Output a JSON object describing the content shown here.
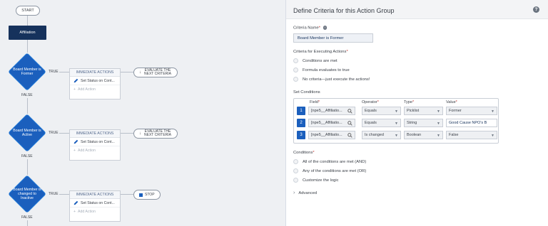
{
  "canvas": {
    "start_label": "START",
    "object_label": "Affiliation",
    "true_label": "TRUE",
    "false_label": "FALSE",
    "criteria": [
      {
        "label": "Board Member is Former",
        "action_header": "IMMEDIATE ACTIONS",
        "action": "Set Status on Cont...",
        "add_action": "Add Action",
        "outcome": "EVALUATE THE NEXT CRITERIA"
      },
      {
        "label": "Board Member is Active",
        "action_header": "IMMEDIATE ACTIONS",
        "action": "Set Status on Cont...",
        "add_action": "Add Action",
        "outcome": "EVALUATE THE NEXT CRITERIA"
      },
      {
        "label": "Board Member is changed to Inactive",
        "action_header": "IMMEDIATE ACTIONS",
        "action": "Set Status on Cont...",
        "add_action": "Add Action",
        "outcome": "STOP"
      }
    ]
  },
  "panel": {
    "title": "Define Criteria for this Action Group",
    "criteria_name_label": "Criteria Name",
    "criteria_name_value": "Board Member is Former",
    "executing_label": "Criteria for Executing Actions",
    "executing_options": [
      "Conditions are met",
      "Formula evaluates to true",
      "No criteria—just execute the actions!"
    ],
    "set_conditions_label": "Set Conditions",
    "columns": {
      "field": "Field",
      "operator": "Operator",
      "type": "Type",
      "value": "Value"
    },
    "rows": [
      {
        "num": "1",
        "field": "[npe5__Affiliatio...",
        "operator": "Equals",
        "type": "Picklist",
        "value": "Former"
      },
      {
        "num": "2",
        "field": "[npe5__Affiliatio...",
        "operator": "Equals",
        "type": "String",
        "value": "Good Cause NPO's B"
      },
      {
        "num": "3",
        "field": "[npe5__Affiliatio...",
        "operator": "Is changed",
        "type": "Boolean",
        "value": "False"
      }
    ],
    "conditions_label": "Conditions",
    "conditions_options": [
      "All of the conditions are met (AND)",
      "Any of the conditions are met (OR)",
      "Customize the logic"
    ],
    "advanced_label": "Advanced"
  }
}
